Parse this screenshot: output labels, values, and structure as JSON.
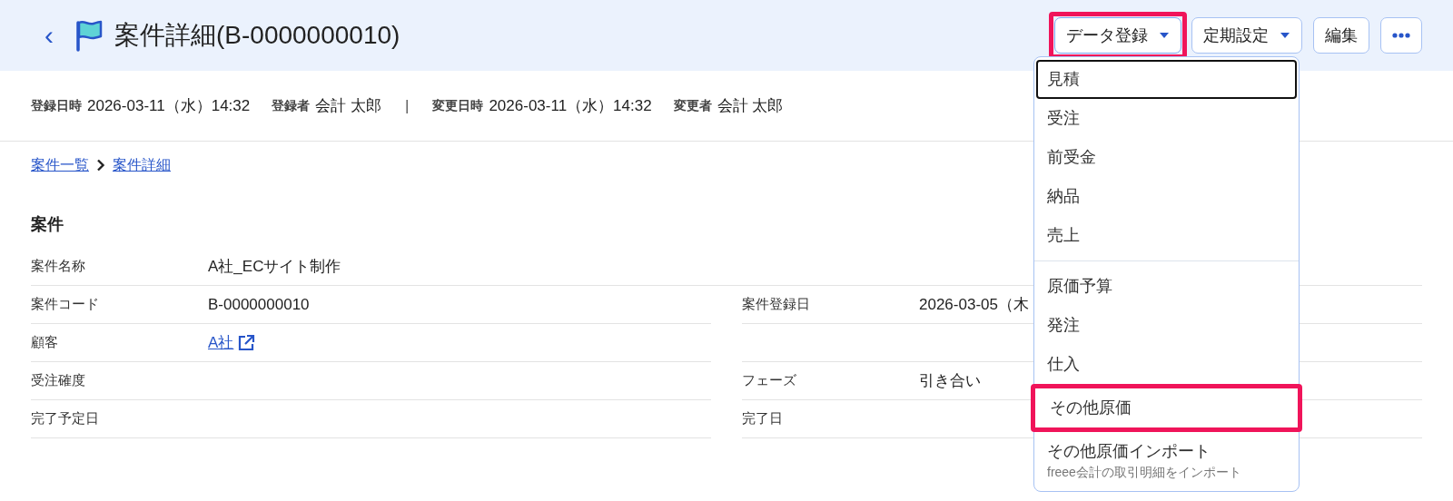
{
  "header": {
    "back": "‹",
    "title": "案件詳細(B-0000000010)",
    "buttons": [
      {
        "kind": "dropdown",
        "label": "データ登録",
        "highlighted": true,
        "expanded": true
      },
      {
        "kind": "dropdown",
        "label": "定期設定",
        "highlighted": false,
        "expanded": false
      },
      {
        "kind": "plain",
        "label": "編集",
        "highlighted": false,
        "expanded": false
      },
      {
        "kind": "more",
        "highlighted": false,
        "expanded": false
      }
    ]
  },
  "meta": [
    {
      "label": "登録日時",
      "value": "2026-03-11（水）14:32"
    },
    {
      "label": "登録者",
      "value": "会計 太郎"
    },
    {
      "kind": "separator",
      "value": "|"
    },
    {
      "label": "変更日時",
      "value": "2026-03-11（水）14:32"
    },
    {
      "label": "変更者",
      "value": "会計 太郎"
    }
  ],
  "breadcrumbs": [
    "案件一覧",
    "案件詳細"
  ],
  "section": {
    "title": "案件",
    "rows": [
      {
        "wide": {
          "label": "案件名称",
          "value": "A社_ECサイト制作"
        }
      },
      {
        "left": {
          "label": "案件コード",
          "value": "B-0000000010"
        },
        "right": {
          "label": "案件登録日",
          "value": "2026-03-05（木"
        }
      },
      {
        "left": {
          "label": "顧客",
          "value": "A社",
          "kind": "link"
        }
      },
      {
        "left": {
          "label": "受注確度"
        },
        "right": {
          "label": "フェーズ",
          "value": "引き合い"
        }
      },
      {
        "left": {
          "label": "完了予定日"
        },
        "right": {
          "label": "完了日"
        }
      }
    ]
  },
  "menu": {
    "groups": [
      [
        {
          "label": "見積",
          "focused": true,
          "highlighted": false
        },
        {
          "label": "受注",
          "focused": false,
          "highlighted": false
        },
        {
          "label": "前受金",
          "focused": false,
          "highlighted": false
        },
        {
          "label": "納品",
          "focused": false,
          "highlighted": false
        },
        {
          "label": "売上",
          "focused": false,
          "highlighted": false
        }
      ],
      [
        {
          "label": "原価予算",
          "focused": false,
          "highlighted": false
        },
        {
          "label": "発注",
          "focused": false,
          "highlighted": false
        },
        {
          "label": "仕入",
          "focused": false,
          "highlighted": false
        },
        {
          "label": "その他原価",
          "focused": false,
          "highlighted": true
        },
        {
          "label": "その他原価インポート",
          "description": "freee会計の取引明細をインポート",
          "focused": false,
          "highlighted": false
        }
      ]
    ]
  }
}
